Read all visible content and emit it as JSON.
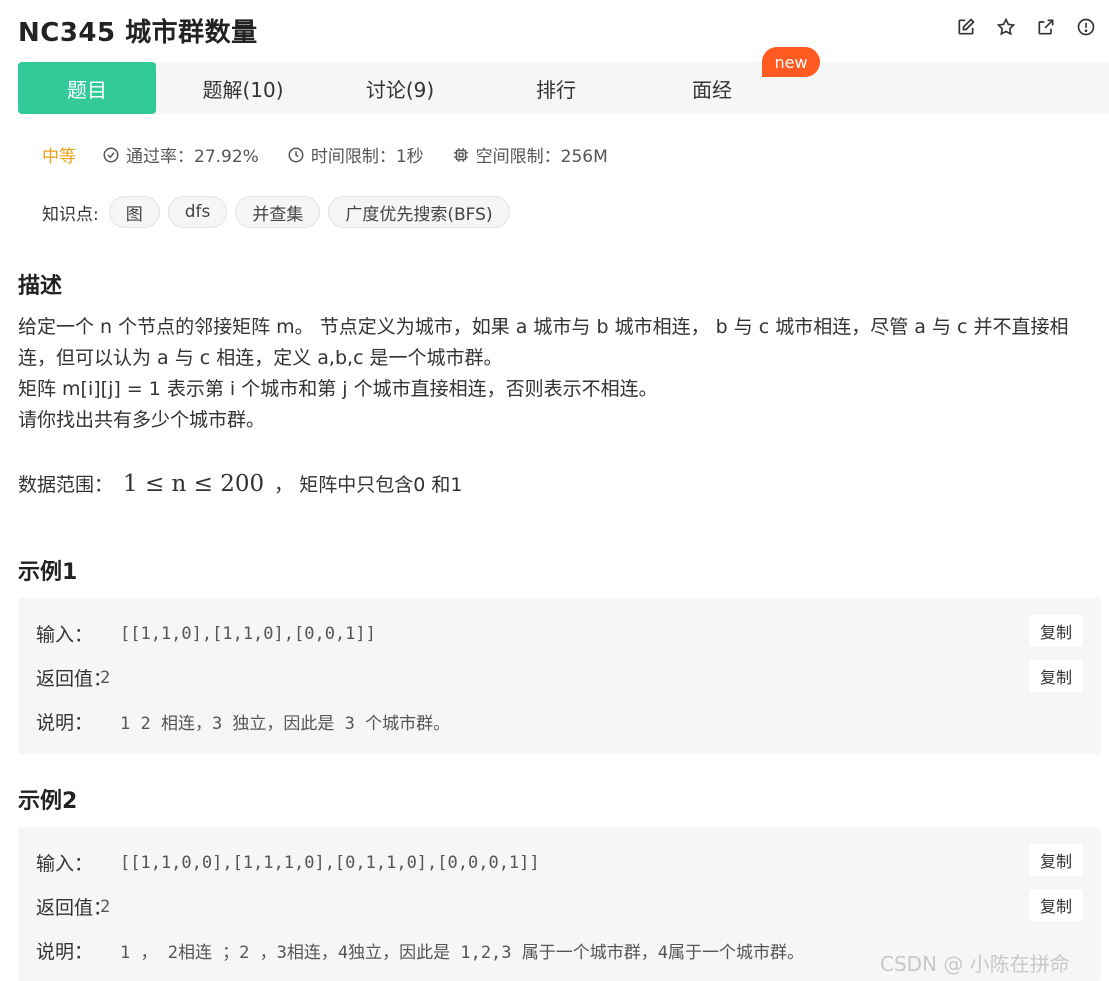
{
  "header": {
    "title": "NC345  城市群数量",
    "icons": [
      "edit-icon",
      "star-icon",
      "external-link-icon",
      "report-icon"
    ]
  },
  "tabs": [
    {
      "label": "题目",
      "active": true
    },
    {
      "label": "题解(10)"
    },
    {
      "label": "讨论(9)"
    },
    {
      "label": "排行"
    },
    {
      "label": "面经"
    }
  ],
  "new_badge": "new",
  "meta": {
    "difficulty": "中等",
    "pass_rate": "通过率：27.92%",
    "time_limit": "时间限制：1秒",
    "space_limit": "空间限制：256M"
  },
  "tags": {
    "label": "知识点:",
    "items": [
      "图",
      "dfs",
      "并查集",
      "广度优先搜索(BFS)"
    ]
  },
  "description": {
    "title": "描述",
    "line1": "给定一个 n 个节点的邻接矩阵 m。 节点定义为城市，如果 a 城市与 b 城市相连， b 与 c 城市相连，尽管 a 与 c 并不直接相连，但可以认为 a 与 c 相连，定义 a,b,c 是一个城市群。",
    "line2": "矩阵 m[i][j] = 1 表示第 i 个城市和第 j 个城市直接相连，否则表示不相连。",
    "line3": "请你找出共有多少个城市群。",
    "range_prefix": "数据范围：",
    "range_math": "1 ≤ n ≤ 200",
    "range_suffix": "，  矩阵中只包含0 和1"
  },
  "examples": [
    {
      "title": "示例1",
      "input_label": "输入：",
      "input": "[[1,1,0],[1,1,0],[0,0,1]]",
      "return_label": "返回值：",
      "return": "2",
      "note_label": "说明：",
      "note": "1 2 相连，3 独立，因此是 3 个城市群。",
      "copy": "复制"
    },
    {
      "title": "示例2",
      "input_label": "输入：",
      "input": "[[1,1,0,0],[1,1,1,0],[0,1,1,0],[0,0,0,1]]",
      "return_label": "返回值：",
      "return": "2",
      "note_label": "说明：",
      "note": "1 ， 2相连 ；2 ，3相连，4独立，因此是 1,2,3 属于一个城市群，4属于一个城市群。",
      "copy": "复制"
    }
  ],
  "watermark": "CSDN @ 小陈在拼命",
  "colors": {
    "accent": "#32ca99",
    "difficulty": "#e8a317",
    "badge": "#ff5a1f"
  }
}
